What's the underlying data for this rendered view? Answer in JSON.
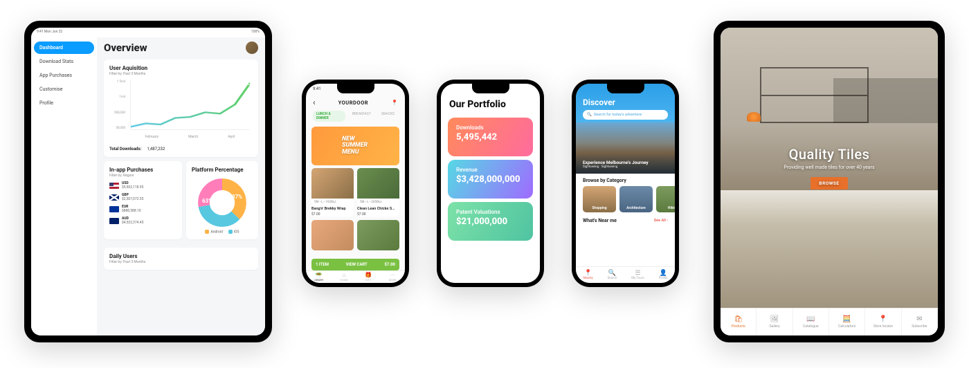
{
  "ipad_dashboard": {
    "status_left": "9:41 Mon Jun 22",
    "status_right": "100%",
    "sidebar": {
      "items": [
        {
          "label": "Dashboard",
          "active": true
        },
        {
          "label": "Download Stats"
        },
        {
          "label": "App Purchases"
        },
        {
          "label": "Customise"
        },
        {
          "label": "Profile"
        }
      ]
    },
    "title": "Overview",
    "user_aq": {
      "heading": "User Aquisition",
      "sub": "Filter by: Past 3 Months",
      "total_label": "Total Downloads:",
      "total_value": "1,487,232"
    },
    "iap": {
      "heading": "In-app Purchases",
      "sub": "Filter by: Region",
      "rows": [
        {
          "code": "USD",
          "value": "$5,902,118.95",
          "flag": "us"
        },
        {
          "code": "GBP",
          "value": "$2,507,072.55",
          "flag": "gb"
        },
        {
          "code": "EUR",
          "value": "$880,588.10",
          "flag": "eu"
        },
        {
          "code": "AUD",
          "value": "$4,522,374.45",
          "flag": "au"
        }
      ]
    },
    "platform": {
      "heading": "Platform Percentage",
      "android_pct": "63%",
      "ios_pct": "37%",
      "legend": {
        "android": "Android",
        "ios": "iOS"
      }
    },
    "daily": {
      "heading": "Daily Users",
      "sub": "Filter by: Past 3 Months"
    }
  },
  "chart_data": {
    "type": "line",
    "title": "User Aquisition",
    "xlabel": "",
    "ylabel": "",
    "categories": [
      "February",
      "March",
      "April"
    ],
    "y_ticks": [
      "1.5mil",
      "1mil",
      "500,000",
      "50,000"
    ],
    "values": [
      80000,
      180000,
      150000,
      350000,
      380000,
      520000,
      480000,
      760000,
      1400000
    ],
    "ylim": [
      0,
      1500000
    ]
  },
  "phone_food": {
    "status_time": "9:41",
    "back": "‹",
    "title": "YOURDOOR",
    "right_icon": "location",
    "tabs": [
      "LUNCH & DINNER",
      "BREAKFAST",
      "SNACKS"
    ],
    "promo_line1": "NEW",
    "promo_line2": "SUMMER",
    "promo_line3": "MENU",
    "items": [
      {
        "meta": "5M • L • 1620kJ",
        "name": "Bang'n' Brekky Wrap",
        "price": "$7.00"
      },
      {
        "meta": "5M • L • 2450kJ",
        "name": "Clean Lean Chicke S…",
        "price": "$7.00"
      }
    ],
    "cart": {
      "count": "1 ITEM",
      "label": "VIEW CART",
      "total": "$7.00"
    },
    "tabbar": [
      "ORDER",
      "HOME",
      "GIFT",
      "MORE"
    ]
  },
  "phone_portfolio": {
    "title": "Our Portfolio",
    "stats": [
      {
        "label": "Downloads",
        "value": "5,495,442"
      },
      {
        "label": "Revenue",
        "value": "$3,428,000,000"
      },
      {
        "label": "Patent Valuations",
        "value": "$21,000,000"
      }
    ]
  },
  "phone_discover": {
    "status_time": "9:41",
    "title": "Discover",
    "search_placeholder": "Search for today's adventure",
    "hero_title": "Experience Melbourne's Journey",
    "hero_sub": "Sightseeing · Sightseeing",
    "sect_browse": "Browse by Category",
    "cats": [
      "Shopping",
      "Architecture",
      "Hiking"
    ],
    "sect_near": "What's Near me",
    "see_all": "See All ›",
    "tabbar": [
      "Nearby",
      "Search",
      "My Tours",
      "Profile"
    ]
  },
  "ipad_tiles": {
    "title": "Quality Tiles",
    "subtitle": "Providing well made tiles for over 40 years",
    "cta": "BROWSE",
    "tabs": [
      "Products",
      "Gallery",
      "Catalogue",
      "Calculators",
      "Store locator",
      "Subscribe"
    ]
  }
}
